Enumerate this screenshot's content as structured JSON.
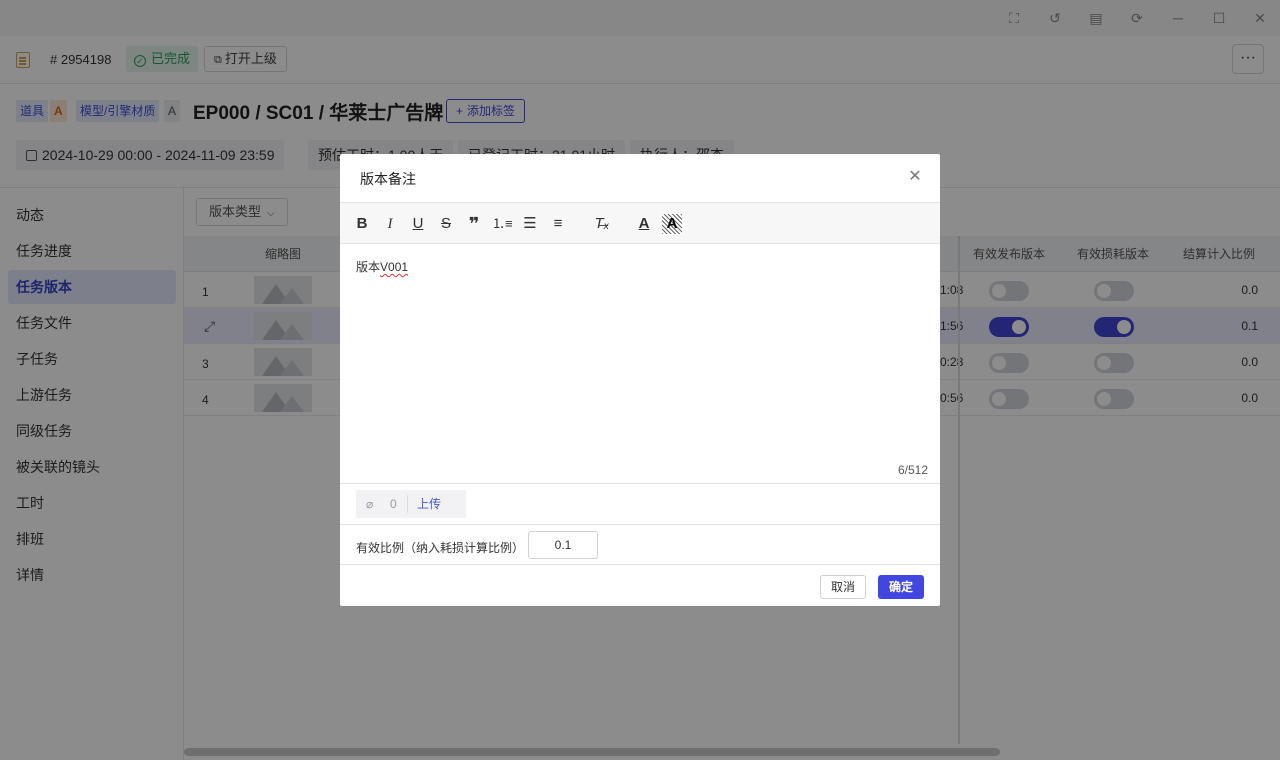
{
  "header": {
    "task_id": "# 2954198",
    "status": "已完成",
    "open_parent": "打开上级",
    "more": "···"
  },
  "entity": {
    "tag1": "道具",
    "tag1_level": "A",
    "tag2": "模型/引擎材质",
    "tag2_level": "A",
    "title": "EP000 / SC01 / 华莱士广告牌",
    "add_tag": "添加标签",
    "date_range": "2024-10-29 00:00 - 2024-11-09 23:59",
    "estimate": "预估工时：1.00人天",
    "logged": "已登记工时：21.01小时",
    "assignee": "执行人：邵杰"
  },
  "sidebar": {
    "items": [
      "动态",
      "任务进度",
      "任务版本",
      "任务文件",
      "子任务",
      "上游任务",
      "同级任务",
      "被关联的镜头",
      "工时",
      "排班",
      "详情"
    ],
    "active_index": 2
  },
  "table": {
    "filter": "版本类型",
    "headers": {
      "thumb": "缩略图",
      "publish": "有效发布版本",
      "consume": "有效损耗版本",
      "ratio": "结算计入比例"
    },
    "rows": [
      {
        "index": "1",
        "time_frag": "1:08",
        "publish": false,
        "consume": false,
        "ratio": "0.0"
      },
      {
        "index": "",
        "time_frag": "1:56",
        "publish": true,
        "consume": true,
        "ratio": "0.1"
      },
      {
        "index": "3",
        "time_frag": "0:28",
        "publish": false,
        "consume": false,
        "ratio": "0.0"
      },
      {
        "index": "4",
        "time_frag": "0:56",
        "publish": false,
        "consume": false,
        "ratio": "0.0"
      }
    ]
  },
  "modal": {
    "title": "版本备注",
    "editor_prefix": "版本",
    "editor_word": "V001",
    "char_count": "6/512",
    "attach_count": "0",
    "upload": "上传",
    "ratio_label": "有效比例（纳入耗损计算比例）",
    "ratio_value": "0.1",
    "cancel": "取消",
    "ok": "确定"
  },
  "colors": {
    "accent": "#4146e0",
    "success": "#2ca05a",
    "warning_tag": "#e06820"
  }
}
